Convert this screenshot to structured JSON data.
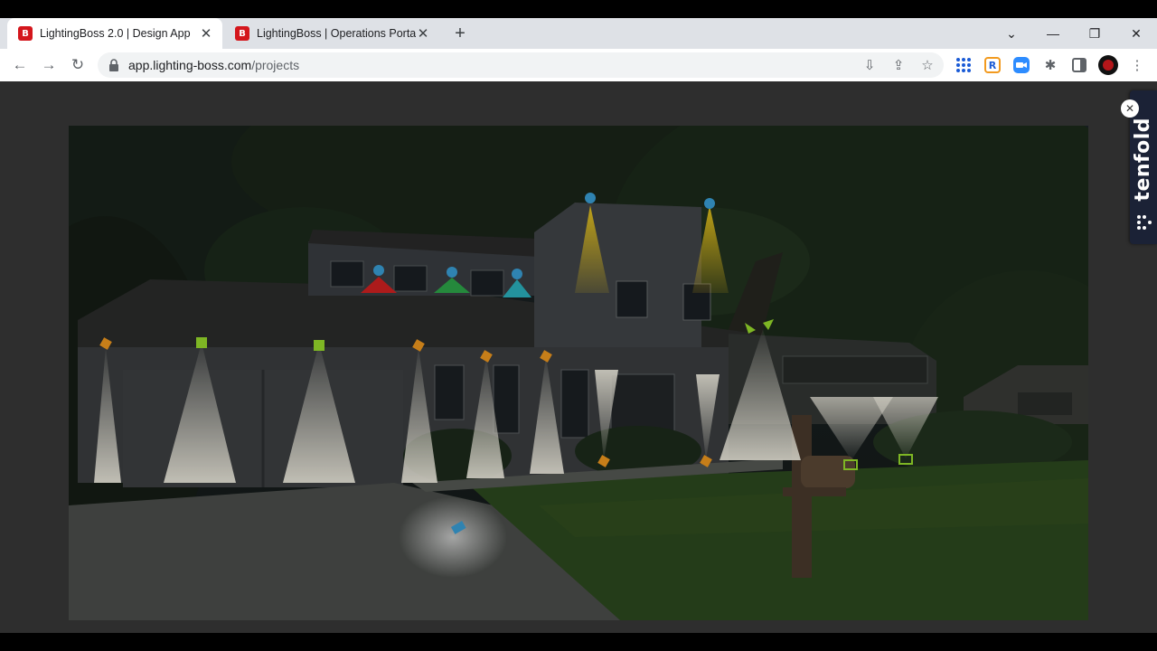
{
  "tabs": [
    {
      "label": "LightingBoss 2.0 | Design App",
      "favicon": "lightingboss-logo-icon",
      "active": true
    },
    {
      "label": "LightingBoss | Operations Portal",
      "favicon": "lightingboss-logo-icon",
      "active": false
    }
  ],
  "favicon_glyph": "B",
  "address": {
    "host": "app.lighting-boss.com",
    "path": "/projects"
  },
  "extension": {
    "name": "tenfold"
  },
  "accent": "#d4161c"
}
